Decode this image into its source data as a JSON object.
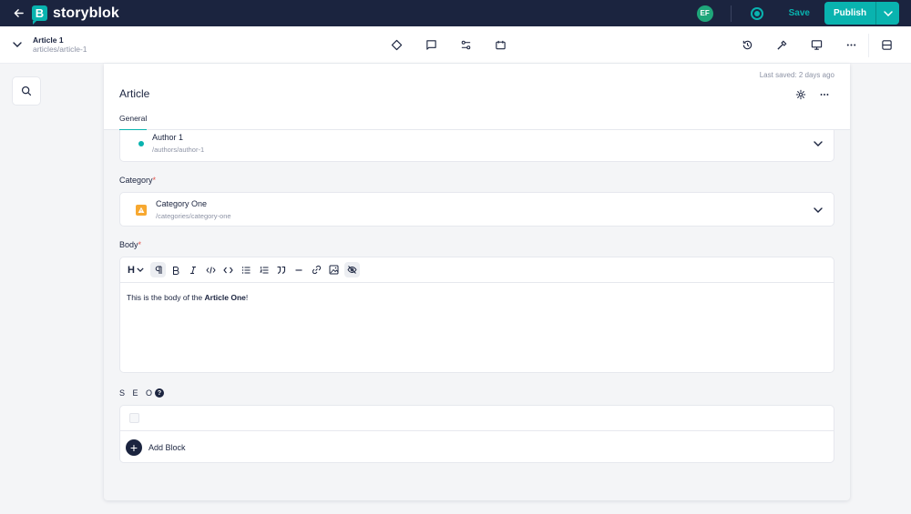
{
  "topbar": {
    "brand": "storyblok",
    "brand_letter": "B",
    "avatar_initials": "EF",
    "save_label": "Save",
    "publish_label": "Publish",
    "accent_color": "#09b3af",
    "bg_color": "#1b243f"
  },
  "story": {
    "title": "Article 1",
    "slug": "articles/article-1"
  },
  "toolbar_icons": {
    "center": [
      "diamond-icon",
      "comment-icon",
      "settings-sliders-icon",
      "calendar-icon"
    ],
    "right": [
      "history-icon",
      "hammer-icon",
      "desktop-icon",
      "more-icon",
      "layout-icon"
    ]
  },
  "panel": {
    "last_saved": "Last saved: 2 days ago",
    "title": "Article",
    "tabs": [
      {
        "label": "General",
        "active": true
      }
    ]
  },
  "fields": {
    "author": {
      "title": "Author 1",
      "path": "/authors/author-1"
    },
    "category": {
      "label": "Category",
      "required": "*",
      "title": "Category One",
      "path": "/categories/category-one"
    },
    "body": {
      "label": "Body",
      "required": "*",
      "toolbar": [
        "heading",
        "paragraph",
        "bold",
        "italic",
        "code",
        "code-block",
        "bullet-list",
        "ordered-list",
        "quote",
        "horizontal-rule",
        "link",
        "image",
        "hide"
      ],
      "heading_label": "H",
      "text_before": "This is the body of the ",
      "text_bold": "Article One",
      "text_after": "!"
    },
    "seo": {
      "label": "S E O",
      "help": "?",
      "add_block_label": "Add Block"
    }
  }
}
